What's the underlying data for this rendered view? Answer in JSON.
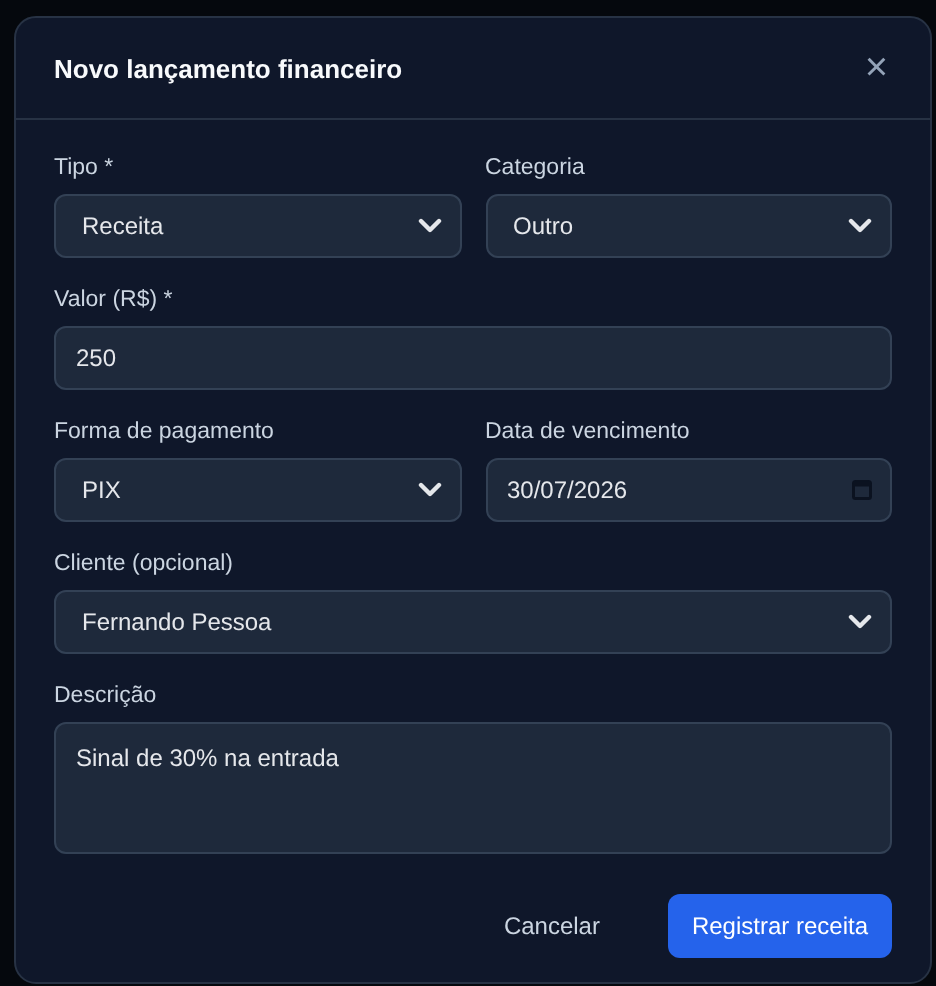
{
  "dialog": {
    "title": "Novo lançamento financeiro",
    "close": "×"
  },
  "rows": [
    [
      {
        "label": "Tipo *",
        "kind": "select",
        "value": "Receita"
      },
      {
        "label": "Categoria",
        "kind": "select",
        "value": "Outro"
      }
    ],
    [
      {
        "label": "Valor (R$) *",
        "kind": "input",
        "value": "250"
      }
    ],
    [
      {
        "label": "Forma de pagamento",
        "kind": "select",
        "value": "PIX"
      },
      {
        "label": "Data de vencimento",
        "kind": "date",
        "value": "30/07/2026"
      }
    ],
    [
      {
        "label": "Cliente (opcional)",
        "kind": "select",
        "value": "Fernando Pessoa"
      }
    ],
    [
      {
        "label": "Descrição",
        "kind": "textarea",
        "value": "Sinal de 30% na entrada"
      }
    ]
  ],
  "buttons": [
    {
      "label": "Cancelar",
      "kind": "secondary"
    },
    {
      "label": "Registrar receita",
      "kind": "primary"
    }
  ]
}
